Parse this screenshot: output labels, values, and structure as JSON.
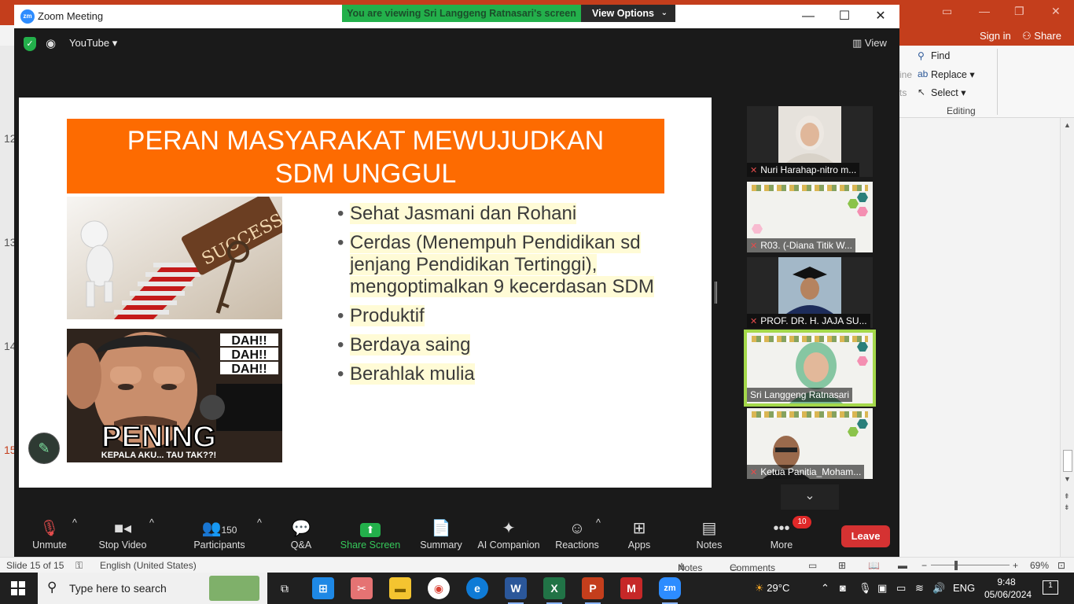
{
  "ppt": {
    "ribbon": {
      "find": "Find",
      "replace": "Replace",
      "select": "Select",
      "group": "Editing",
      "faded1": "ine",
      "faded2": "ts"
    },
    "topbar": {
      "signin": "Sign in",
      "share": "Share"
    },
    "left_numbers": [
      "12",
      "13",
      "14",
      "15"
    ],
    "status": {
      "slide": "Slide 15 of 15",
      "language": "English (United States)",
      "notes": "Notes",
      "comments": "Comments",
      "zoom": "69%"
    }
  },
  "zoom": {
    "window_title": "Zoom Meeting",
    "logo": "zm",
    "banner": "You are viewing Sri Langgeng Ratnasari's screen",
    "view_options": "View Options",
    "source_dropdown": "YouTube",
    "view_button": "View",
    "slide": {
      "title_line1": "PERAN MASYARAKAT MEWUJUDKAN",
      "title_line2": "SDM UNGGUL",
      "image1_word": "SUCCESS",
      "image2_caption1": "DAH!!",
      "image2_caption2": "DAH!!",
      "image2_caption3": "DAH!!",
      "image2_big": "PENING",
      "image2_small": "KEPALA AKU... TAU TAK??!",
      "bullets": [
        "Sehat Jasmani dan Rohani",
        "Cerdas (Menempuh Pendidikan sd jenjang Pendidikan Tertinggi), mengoptimalkan 9 kecerdasan SDM",
        "Produktif",
        "Berdaya saing",
        "Berahlak mulia"
      ]
    },
    "participants": [
      {
        "name": "Nuri Harahap-nitro m..."
      },
      {
        "name": "R03. (-Diana Titik W..."
      },
      {
        "name": "PROF. DR. H. JAJA SU..."
      },
      {
        "name": "Sri Langgeng Ratnasari"
      },
      {
        "name": "Ketua Panitia_Moham..."
      }
    ],
    "toolbar": {
      "unmute": "Unmute",
      "stop_video": "Stop Video",
      "participants": "Participants",
      "participant_count": "150",
      "qa": "Q&A",
      "share_screen": "Share Screen",
      "summary": "Summary",
      "ai_companion": "AI Companion",
      "reactions": "Reactions",
      "apps": "Apps",
      "notes": "Notes",
      "more": "More",
      "more_badge": "10",
      "leave": "Leave"
    }
  },
  "taskbar": {
    "search_placeholder": "Type here to search",
    "weather": "29°C",
    "language": "ENG",
    "time": "9:48",
    "date": "05/06/2024",
    "notifications": "1"
  },
  "colors": {
    "zoom_green": "#23b04b",
    "slide_orange": "#fd6b01",
    "leave_red": "#d53232",
    "ppt_red": "#c43e1c"
  }
}
